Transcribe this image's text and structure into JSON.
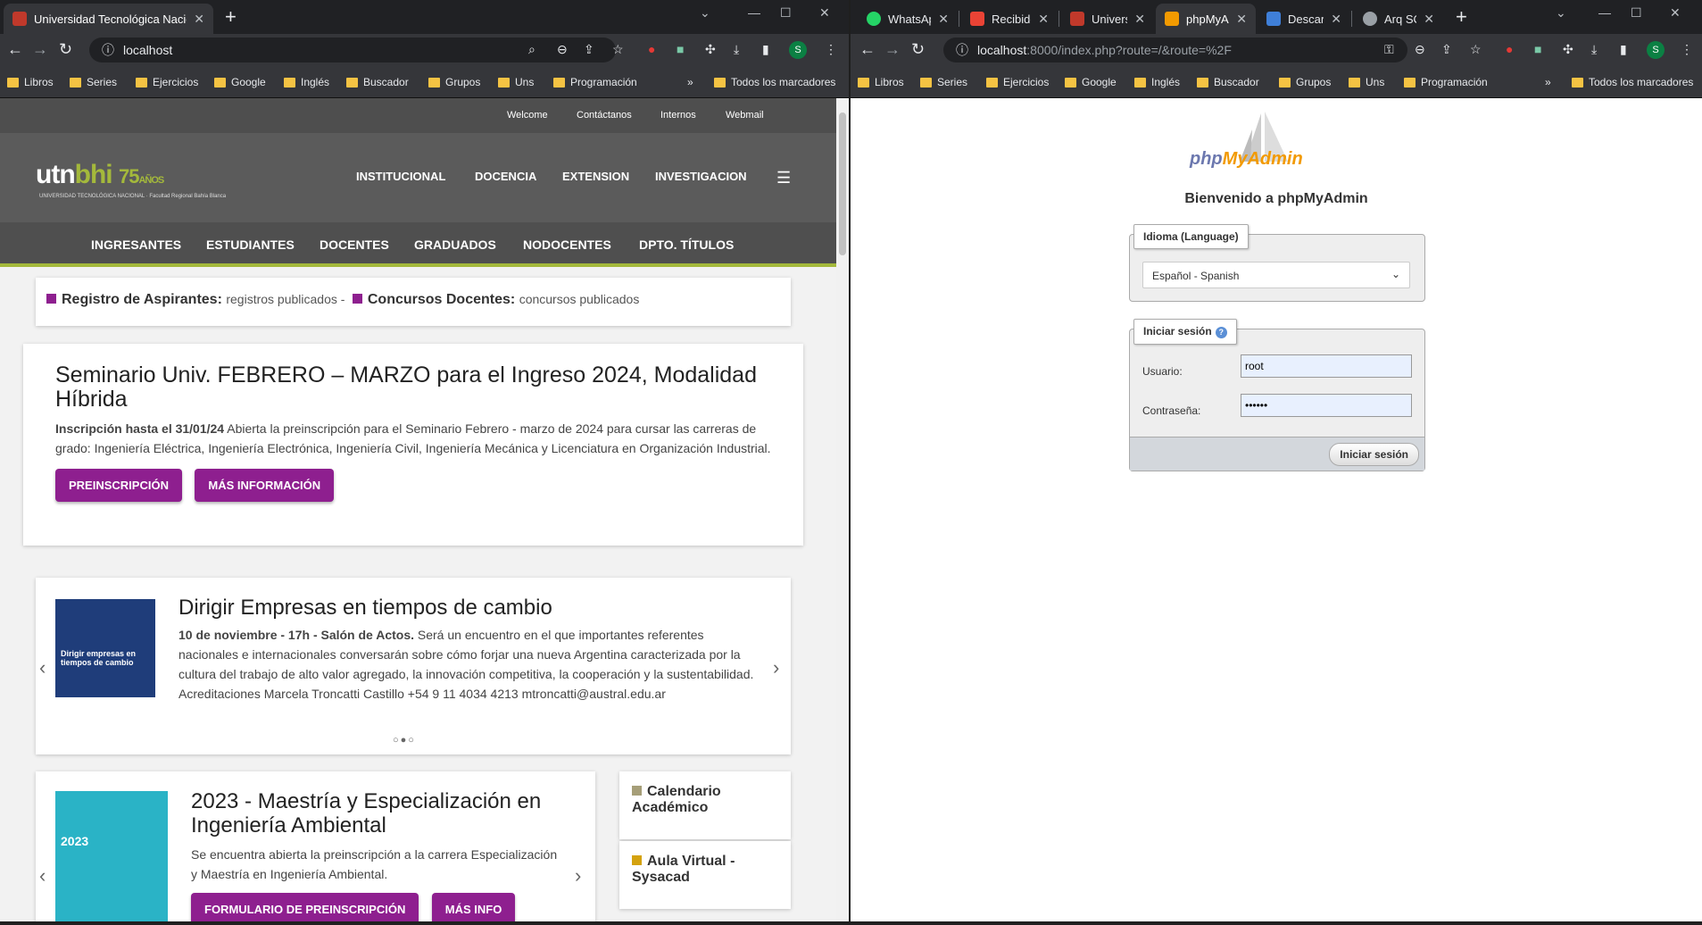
{
  "left": {
    "tab_title": "Universidad Tecnológica Nacional",
    "url": "localhost",
    "bookmarks": [
      "Libros",
      "Series",
      "Ejercicios",
      "Google",
      "Inglés",
      "Buscador",
      "Grupos",
      "Uns",
      "Programación"
    ],
    "bookmarks_more": "»",
    "all_bookmarks": "Todos los marcadores",
    "top_links": [
      "Welcome",
      "Contáctanos",
      "Internos",
      "Webmail"
    ],
    "logo": {
      "utn": "utn",
      "bhi": "bhi",
      "years": "75",
      "anios": "AÑOS",
      "sub": "UNIVERSIDAD TECNOLÓGICA NACIONAL · Facultad Regional Bahía Blanca"
    },
    "main_nav": [
      "INSTITUCIONAL",
      "DOCENCIA",
      "EXTENSION",
      "INVESTIGACION"
    ],
    "sub_nav": [
      "INGRESANTES",
      "ESTUDIANTES",
      "DOCENTES",
      "GRADUADOS",
      "NODOCENTES",
      "DPTO. TÍTULOS"
    ],
    "notice": {
      "a_title": "Registro de Aspirantes:",
      "a_sub": "registros publicados -",
      "b_title": "Concursos Docentes:",
      "b_sub": "concursos publicados"
    },
    "hero": {
      "title": "Seminario Univ. FEBRERO – MARZO para el Ingreso 2024, Modalidad Híbrida",
      "lead": "Inscripción hasta el 31/01/24",
      "text": " Abierta la preinscripción para el Seminario Febrero - marzo de 2024 para cursar las carreras de grado: Ingeniería Eléctrica, Ingeniería Electrónica, Ingeniería Civil, Ingeniería Mecánica y Licenciatura en Organización Industrial.",
      "btn1": "PREINSCRIPCIÓN",
      "btn2": "MÁS INFORMACIÓN"
    },
    "slide": {
      "title": "Dirigir Empresas en tiempos de cambio",
      "lead": "10 de noviembre - 17h - Salón de Actos.",
      "text": " Será un encuentro en el que importantes referentes nacionales e internacionales conversarán sobre cómo forjar una nueva Argentina caracterizada por la cultura del trabajo de alto valor agregado, la innovación competitiva, la cooperación y la sustentabilidad. Acreditaciones Marcela Troncatti Castillo +54 9 11 4034 4213 mtroncatti@austral.edu.ar",
      "thumb": "Dirigir empresas en tiempos de cambio",
      "dots": "○●○"
    },
    "slide2": {
      "title": "2023 - Maestría y Especialización en Ingeniería Ambiental",
      "text": "Se encuentra abierta la preinscripción a la carrera Especialización y Maestría en Ingeniería Ambiental.",
      "btn1": "FORMULARIO DE PREINSCRIPCIÓN",
      "btn2": "MÁS INFO",
      "thumb": "2023"
    },
    "side": [
      "Calendario Académico",
      "Aula Virtual - Sysacad"
    ]
  },
  "right": {
    "tabs": [
      "WhatsApp",
      "Recibidos",
      "Universidad",
      "phpMyAdmin",
      "Descargas",
      "Arq SO"
    ],
    "url_host": "localhost",
    "url_path": ":8000/index.php?route=/&route=%2F",
    "bookmarks": [
      "Libros",
      "Series",
      "Ejercicios",
      "Google",
      "Inglés",
      "Buscador",
      "Grupos",
      "Uns",
      "Programación"
    ],
    "bookmarks_more": "»",
    "all_bookmarks": "Todos los marcadores",
    "logo_php": "php",
    "logo_my": "MyAdmin",
    "welcome": "Bienvenido a phpMyAdmin",
    "lang_legend": "Idioma (Language)",
    "lang_value": "Español - Spanish",
    "login_legend": "Iniciar sesión",
    "user_label": "Usuario:",
    "user_value": "root",
    "pass_label": "Contraseña:",
    "pass_value": "••••••",
    "submit": "Iniciar sesión"
  },
  "colors": {
    "utn_green": "#a4b93b",
    "utn_purple": "#8e1f8f",
    "pma_orange": "#f29a00",
    "pma_blue": "#6c78af"
  }
}
